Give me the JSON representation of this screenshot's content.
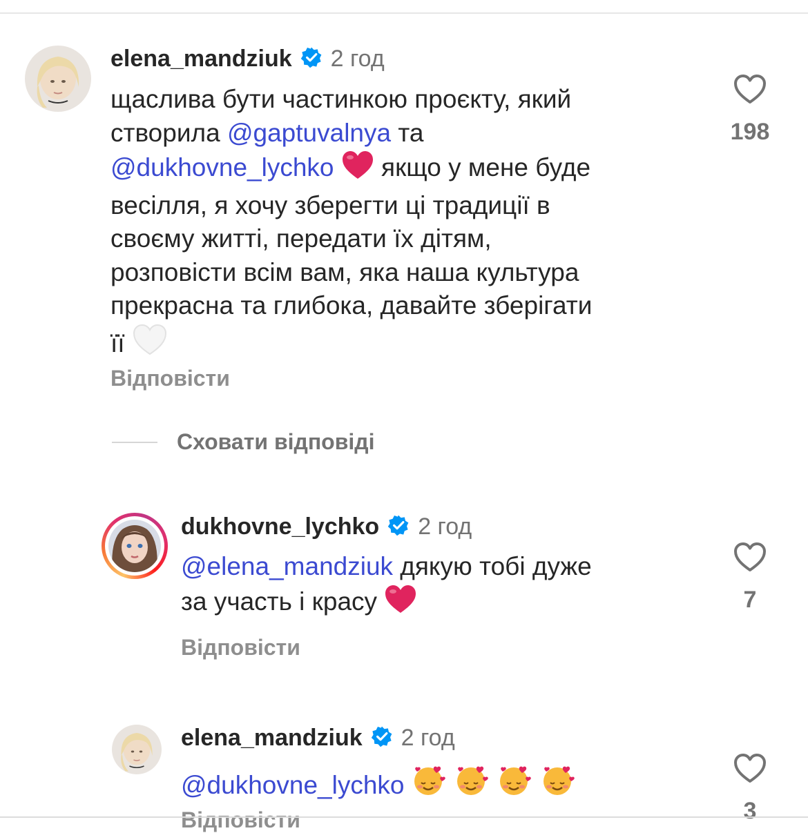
{
  "comments": [
    {
      "username": "elena_mandziuk",
      "time": "2 год",
      "verified": true,
      "avatar_icon": "user-avatar-blonde",
      "line1": "щаслива бути частинкою проєкту, який",
      "line2_pre": "створила ",
      "line2_mention": "@gaptuvalnya",
      "line2_post": " та",
      "line3_mention": "@dukhovne_lychko",
      "line3_post": " якщо у мене буде",
      "line4": "весілля, я хочу зберегти ці традиції в",
      "line5": "своєму житті, передати їх дітям,",
      "line6": "розповісти всім вам, яка наша культура",
      "line7": "прекрасна та глибока, давайте зберігати",
      "line8": "її",
      "reply_label": "Відповісти",
      "likes": "198"
    },
    {
      "username": "dukhovne_lychko",
      "time": "2 год",
      "verified": true,
      "avatar_icon": "user-avatar-story-ring",
      "line1_mention": "@elena_mandziuk",
      "line1_post": " дякую тобі дуже",
      "line2": "за участь і красу",
      "reply_label": "Відповісти",
      "likes": "7"
    },
    {
      "username": "elena_mandziuk",
      "time": "2 год",
      "verified": true,
      "avatar_icon": "user-avatar-blonde",
      "line1_mention": "@dukhovne_lychko",
      "reply_label": "Відповісти",
      "likes": "3"
    }
  ],
  "hide_replies_label": "Сховати відповіді",
  "colors": {
    "mention": "#3b4ad1",
    "verified": "#0095f6",
    "muted": "#737373",
    "red_heart": "#e0245e"
  }
}
